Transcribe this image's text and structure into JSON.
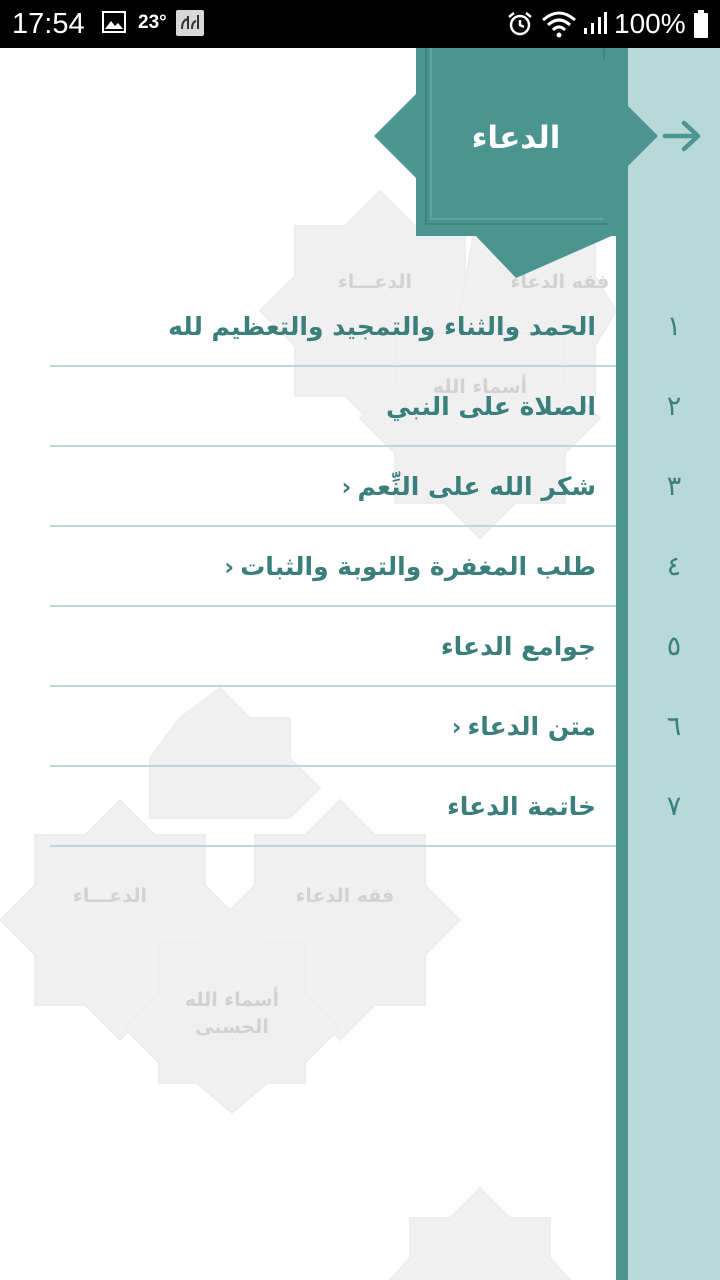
{
  "status_bar": {
    "time": "17:54",
    "temperature": "23°",
    "battery": "100%",
    "icons": [
      "image-icon",
      "app-badge-icon",
      "alarm-icon",
      "wifi-icon",
      "signal-icon",
      "battery-icon"
    ]
  },
  "header": {
    "title": "الدعاء"
  },
  "watermark": {
    "labels": [
      "الدعـــاء",
      "فقه الدعاء",
      "أسماء الله",
      "الحسنى",
      "الدعـــاء",
      "فقه الدعاء",
      "أسماء الله"
    ]
  },
  "menu": {
    "items": [
      {
        "number": "١",
        "label": "الحمد والثناء والتمجيد والتعظيم لله",
        "chevron": ""
      },
      {
        "number": "٢",
        "label": "الصلاة على النبي",
        "chevron": ""
      },
      {
        "number": "٣",
        "label": "شكر الله على النِّعم",
        "chevron": "‹"
      },
      {
        "number": "٤",
        "label": "طلب المغفرة والتوبة والثبات",
        "chevron": "‹"
      },
      {
        "number": "٥",
        "label": "جوامع الدعاء",
        "chevron": ""
      },
      {
        "number": "٦",
        "label": "متن الدعاء",
        "chevron": "‹"
      },
      {
        "number": "٧",
        "label": "خاتمة الدعاء",
        "chevron": ""
      }
    ]
  },
  "colors": {
    "teal_dark": "#4b9490",
    "teal_text": "#3a7f7b",
    "rail_light": "#b7dad9",
    "status_bar": "#000000"
  }
}
